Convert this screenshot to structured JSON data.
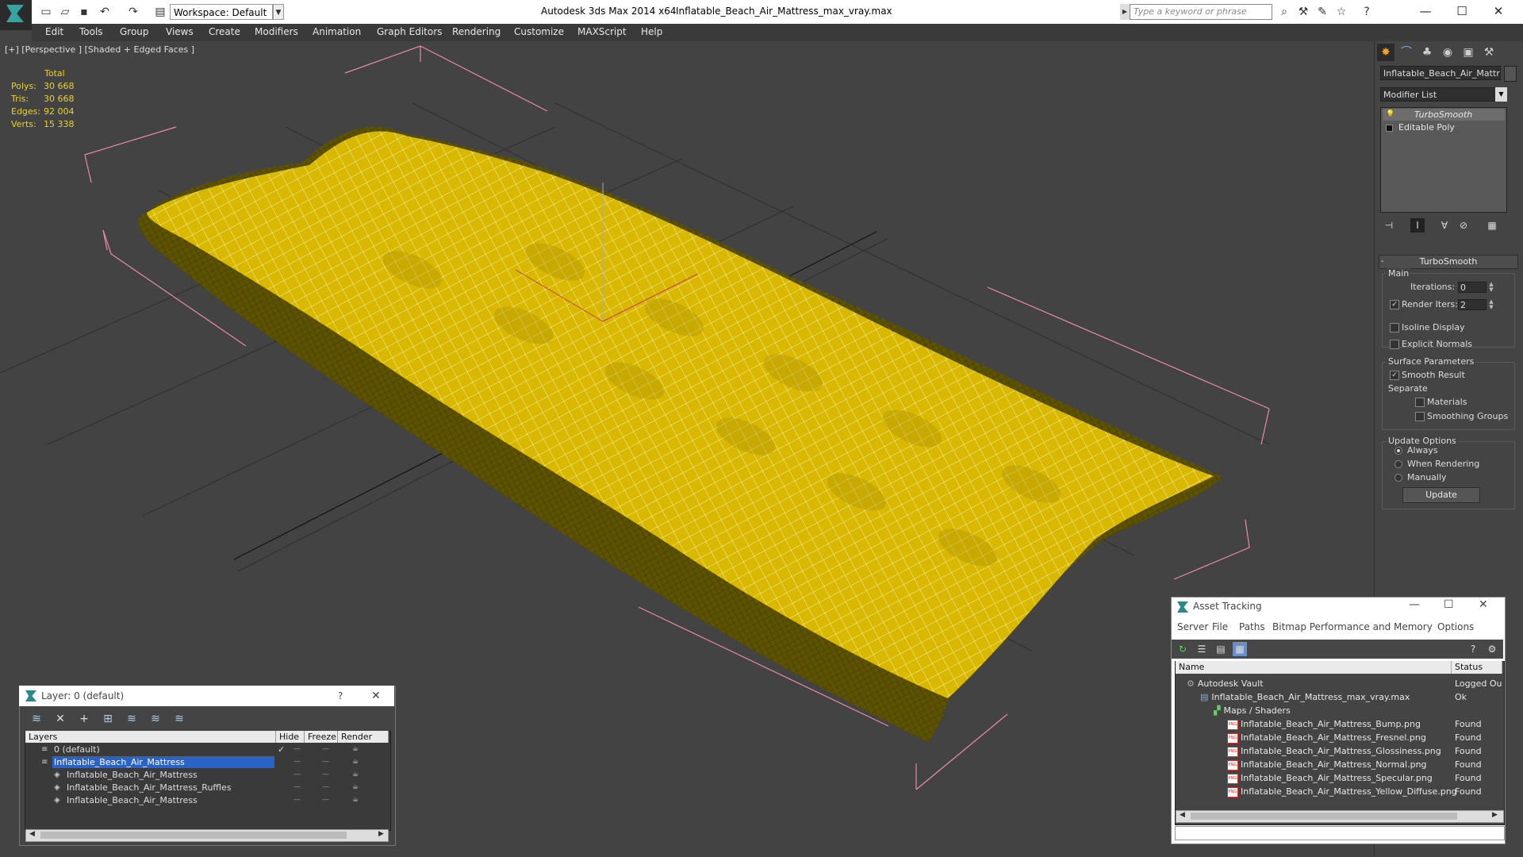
{
  "titlebar": {
    "workspace": "Workspace: Default",
    "app_title": "Autodesk 3ds Max  2014 x64",
    "file_title": "Inflatable_Beach_Air_Mattress_max_vray.max",
    "search_placeholder": "Type a keyword or phrase"
  },
  "menu": [
    "Edit",
    "Tools",
    "Group",
    "Views",
    "Create",
    "Modifiers",
    "Animation",
    "Graph Editors",
    "Rendering",
    "Customize",
    "MAXScript",
    "Help"
  ],
  "viewport": {
    "label": "[+] [Perspective ] [Shaded + Edged Faces ]",
    "stats_header": "Total",
    "stats": [
      {
        "label": "Polys:",
        "value": "30 668"
      },
      {
        "label": "Tris:",
        "value": "30 668"
      },
      {
        "label": "Edges:",
        "value": "92 004"
      },
      {
        "label": "Verts:",
        "value": "15 338"
      }
    ],
    "mesh_color": "#e6c100"
  },
  "command_panel": {
    "object_name": "Inflatable_Beach_Air_Mattress",
    "modifier_list": "Modifier List",
    "stack": [
      "TurboSmooth",
      "Editable Poly"
    ],
    "rollout_title": "TurboSmooth",
    "main_label": "Main",
    "iterations_label": "Iterations:",
    "iterations_value": "0",
    "render_iters_label": "Render Iters:",
    "render_iters_value": "2",
    "isoline": "Isoline Display",
    "explicit_normals": "Explicit Normals",
    "surface_params": "Surface Parameters",
    "smooth_result": "Smooth Result",
    "separate": "Separate",
    "materials": "Materials",
    "smoothing_groups": "Smoothing Groups",
    "update_options": "Update Options",
    "always": "Always",
    "when_rendering": "When Rendering",
    "manually": "Manually",
    "update_button": "Update"
  },
  "layer_dialog": {
    "title": "Layer: 0 (default)",
    "help": "?",
    "columns": [
      "Layers",
      "Hide",
      "Freeze",
      "Render"
    ],
    "rows": [
      {
        "name": "0 (default)",
        "indent": 0
      },
      {
        "name": "Inflatable_Beach_Air_Mattress",
        "indent": 0
      },
      {
        "name": "Inflatable_Beach_Air_Mattress",
        "indent": 1
      },
      {
        "name": "Inflatable_Beach_Air_Mattress_Ruffles",
        "indent": 1
      },
      {
        "name": "Inflatable_Beach_Air_Mattress",
        "indent": 1
      }
    ],
    "dash": "—"
  },
  "asset_tracking": {
    "title": "Asset Tracking",
    "menu": [
      "Server",
      "File",
      "Paths",
      "Bitmap Performance and Memory",
      "Options"
    ],
    "columns": [
      "Name",
      "Status"
    ],
    "rows": [
      {
        "name": "Autodesk Vault",
        "status": "Logged Ou",
        "indent": 1
      },
      {
        "name": "Inflatable_Beach_Air_Mattress_max_vray.max",
        "status": "Ok",
        "indent": 2
      },
      {
        "name": "Maps / Shaders",
        "status": "",
        "indent": 3
      },
      {
        "name": "Inflatable_Beach_Air_Mattress_Bump.png",
        "status": "Found",
        "indent": 4
      },
      {
        "name": "Inflatable_Beach_Air_Mattress_Fresnel.png",
        "status": "Found",
        "indent": 4
      },
      {
        "name": "Inflatable_Beach_Air_Mattress_Glossiness.png",
        "status": "Found",
        "indent": 4
      },
      {
        "name": "Inflatable_Beach_Air_Mattress_Normal.png",
        "status": "Found",
        "indent": 4
      },
      {
        "name": "Inflatable_Beach_Air_Mattress_Specular.png",
        "status": "Found",
        "indent": 4
      },
      {
        "name": "Inflatable_Beach_Air_Mattress_Yellow_Diffuse.png",
        "status": "Found",
        "indent": 4
      }
    ]
  }
}
